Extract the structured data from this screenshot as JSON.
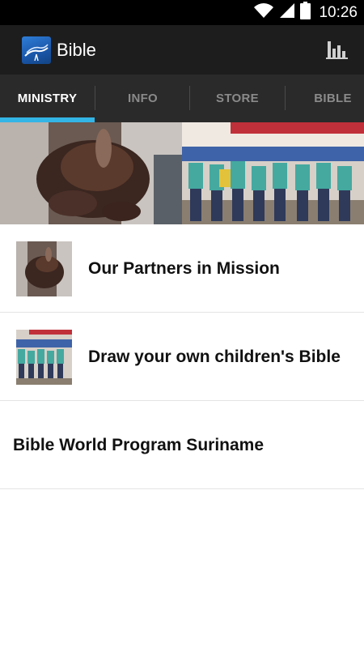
{
  "status_bar": {
    "time": "10:26",
    "icons": [
      "wifi-icon",
      "signal-icon",
      "battery-icon"
    ]
  },
  "action_bar": {
    "title": "Bible",
    "logo_icon": "bible-logo-icon",
    "action_icon": "bar-chart-icon"
  },
  "tabs": [
    {
      "label": "MINISTRY",
      "active": true
    },
    {
      "label": "INFO",
      "active": false
    },
    {
      "label": "STORE",
      "active": false
    },
    {
      "label": "BIBLE",
      "active": false
    }
  ],
  "colors": {
    "tab_indicator": "#33b5e5",
    "action_bar": "#1d1d1d",
    "tab_bar": "#2a2a2a"
  },
  "list": {
    "items": [
      {
        "title": "Our Partners in Mission",
        "thumbnail": "handshake-photo"
      },
      {
        "title": "Draw your own children's Bible",
        "thumbnail": "children-group-photo"
      },
      {
        "title": "Bible World Program Suriname",
        "thumbnail": ""
      }
    ]
  }
}
